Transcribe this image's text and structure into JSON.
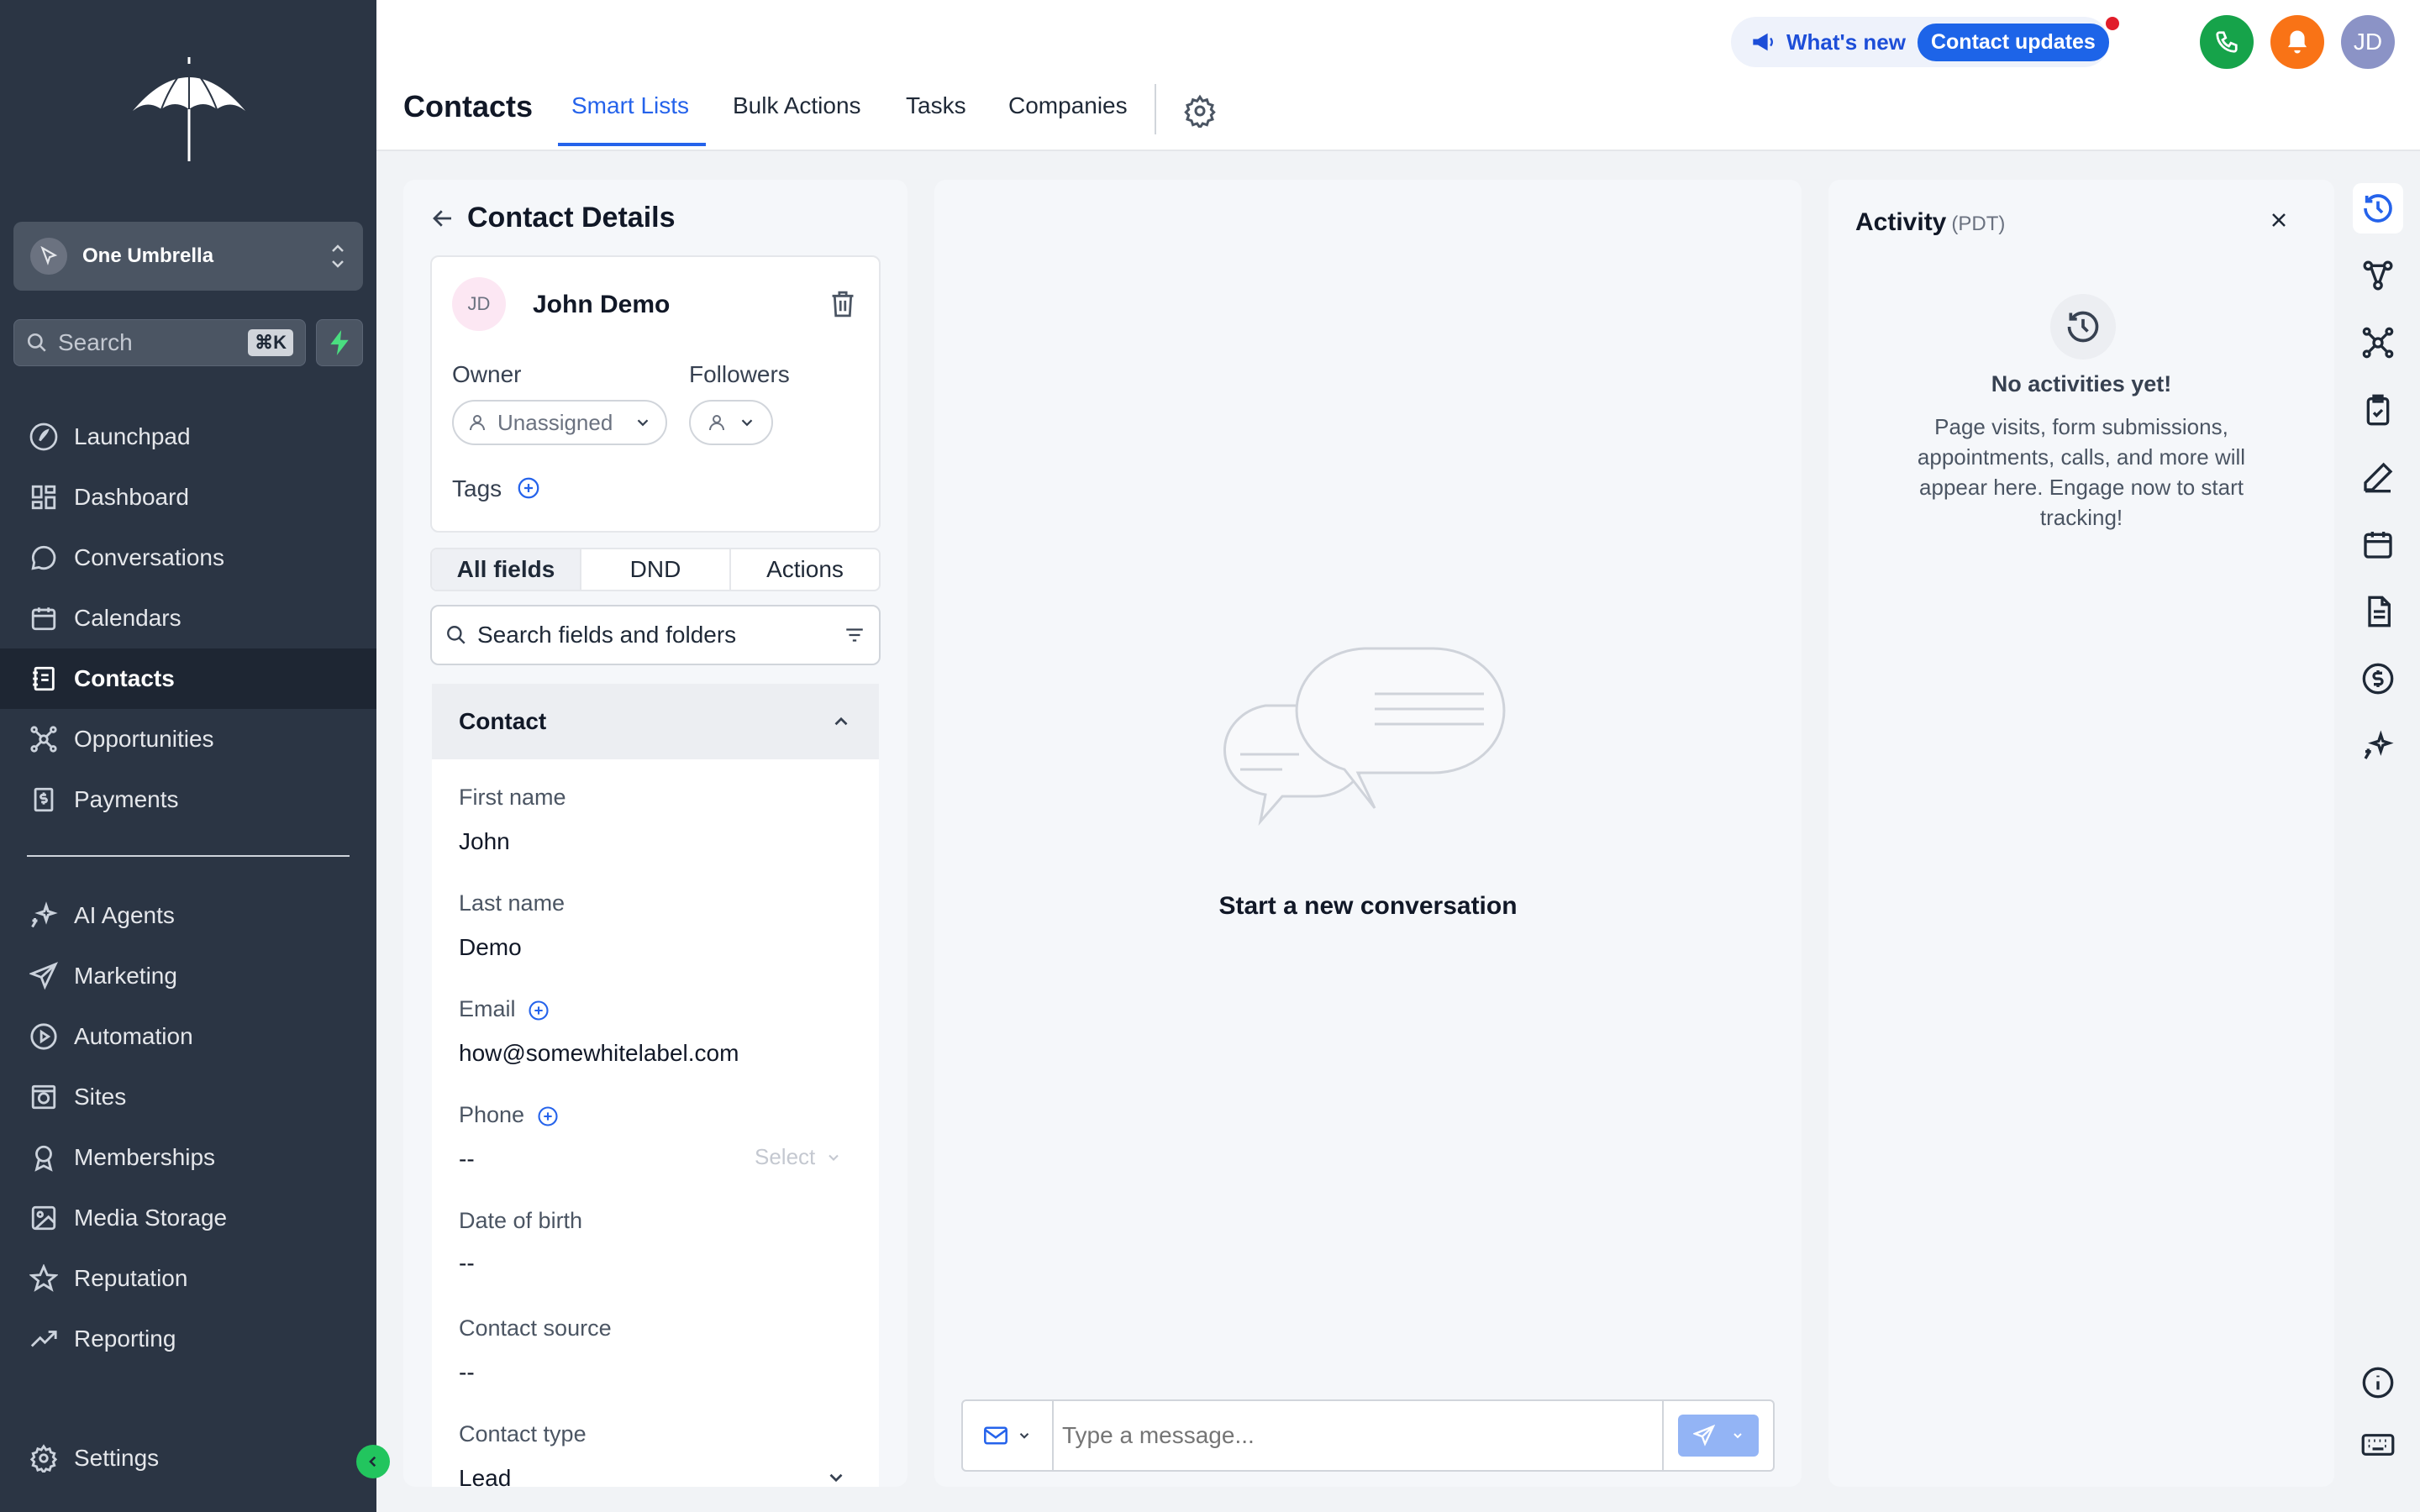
{
  "colors": {
    "sidebar_bg": "#2b3544",
    "accent": "#2563eb",
    "phone_green": "#16a34a",
    "bell_orange": "#f97316",
    "collapse_green": "#22c55e"
  },
  "sidebar": {
    "account_name": "One Umbrella",
    "search_label": "Search",
    "search_shortcut": "⌘K",
    "items": [
      {
        "label": "Launchpad",
        "icon": "rocket-icon"
      },
      {
        "label": "Dashboard",
        "icon": "grid-icon"
      },
      {
        "label": "Conversations",
        "icon": "chat-icon"
      },
      {
        "label": "Calendars",
        "icon": "calendar-icon"
      },
      {
        "label": "Contacts",
        "icon": "contacts-icon"
      },
      {
        "label": "Opportunities",
        "icon": "opportunities-icon"
      },
      {
        "label": "Payments",
        "icon": "payments-icon"
      },
      {
        "label": "AI Agents",
        "icon": "sparkle-icon"
      },
      {
        "label": "Marketing",
        "icon": "send-icon"
      },
      {
        "label": "Automation",
        "icon": "play-icon"
      },
      {
        "label": "Sites",
        "icon": "globe-icon"
      },
      {
        "label": "Memberships",
        "icon": "badge-icon"
      },
      {
        "label": "Media Storage",
        "icon": "image-icon"
      },
      {
        "label": "Reputation",
        "icon": "star-icon"
      },
      {
        "label": "Reporting",
        "icon": "trend-icon"
      },
      {
        "label": "Settings",
        "icon": "gear-icon"
      }
    ],
    "active": "Contacts"
  },
  "header": {
    "title": "Contacts",
    "tabs": [
      "Smart Lists",
      "Bulk Actions",
      "Tasks",
      "Companies"
    ],
    "active_tab": "Smart Lists",
    "whats_new": "What's new",
    "contact_updates": "Contact updates",
    "user_initials": "JD"
  },
  "contact": {
    "panel_title": "Contact Details",
    "initials": "JD",
    "name": "John Demo",
    "owner_label": "Owner",
    "owner_value": "Unassigned",
    "followers_label": "Followers",
    "tags_label": "Tags",
    "segments": [
      "All fields",
      "DND",
      "Actions"
    ],
    "active_segment": "All fields",
    "search_placeholder": "Search fields and folders",
    "section_title": "Contact",
    "fields": {
      "first_name_label": "First name",
      "first_name": "John",
      "last_name_label": "Last name",
      "last_name": "Demo",
      "email_label": "Email",
      "email": "how@somewhitelabel.com",
      "phone_label": "Phone",
      "phone": "--",
      "phone_select": "Select",
      "dob_label": "Date of birth",
      "dob": "--",
      "source_label": "Contact source",
      "source": "--",
      "type_label": "Contact type",
      "type": "Lead"
    }
  },
  "conversation": {
    "empty_text": "Start a new conversation",
    "message_placeholder": "Type a message..."
  },
  "activity": {
    "title": "Activity",
    "timezone": "(PDT)",
    "empty_title": "No activities yet!",
    "empty_desc": "Page visits, form submissions, appointments, calls, and more will appear here. Engage now to start tracking!"
  },
  "rail_icons": [
    "activity-icon",
    "workflow-icon",
    "opportunities-icon",
    "tasks-icon",
    "notes-icon",
    "appointments-icon",
    "documents-icon",
    "payments-icon",
    "ai-icon",
    "info-icon",
    "keyboard-icon"
  ]
}
